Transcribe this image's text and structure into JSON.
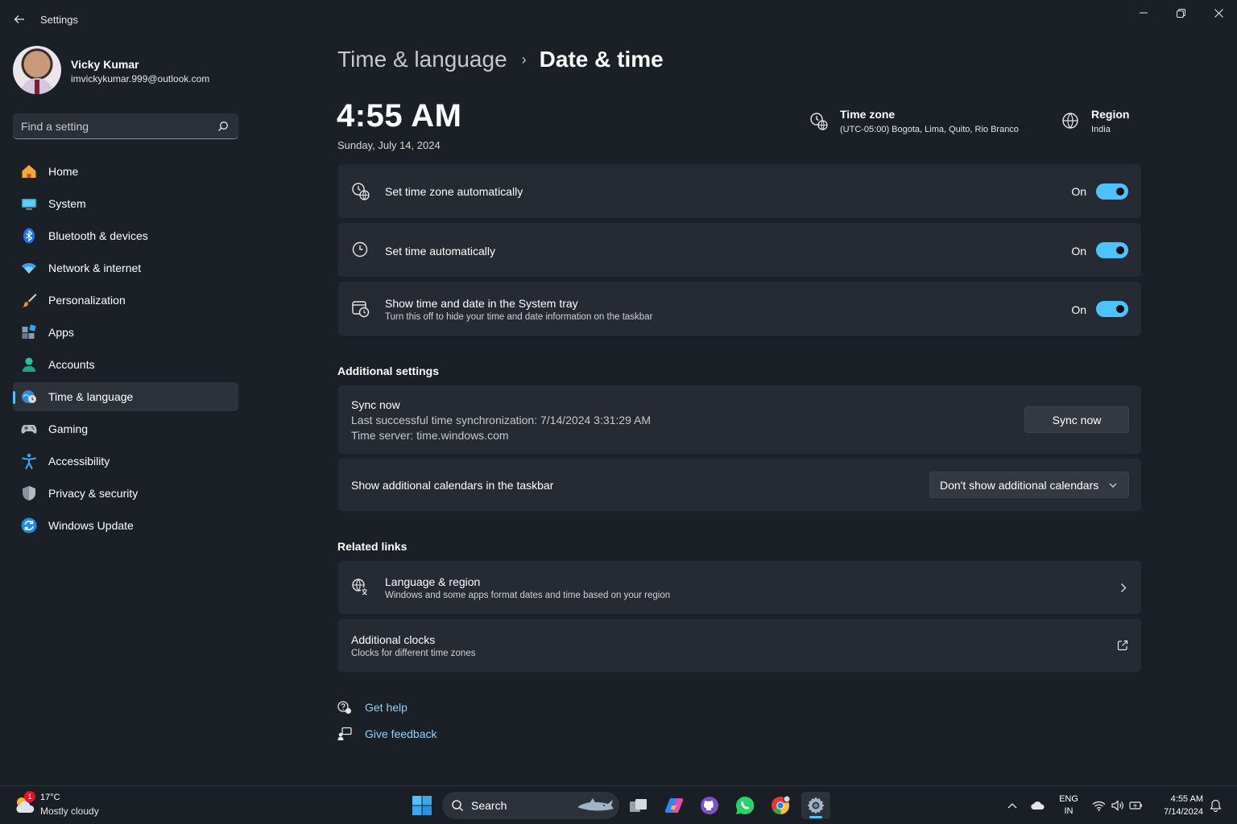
{
  "window": {
    "title": "Settings",
    "controls": {
      "minimize": "—",
      "restore": "❐",
      "close": "✕"
    }
  },
  "profile": {
    "name": "Vicky Kumar",
    "email": "imvickykumar.999@outlook.com"
  },
  "search": {
    "placeholder": "Find a setting"
  },
  "sidebar": {
    "items": [
      {
        "label": "Home",
        "icon": "home-icon"
      },
      {
        "label": "System",
        "icon": "system-icon"
      },
      {
        "label": "Bluetooth & devices",
        "icon": "bluetooth-icon"
      },
      {
        "label": "Network & internet",
        "icon": "wifi-icon"
      },
      {
        "label": "Personalization",
        "icon": "brush-icon"
      },
      {
        "label": "Apps",
        "icon": "apps-icon"
      },
      {
        "label": "Accounts",
        "icon": "accounts-icon"
      },
      {
        "label": "Time & language",
        "icon": "time-language-icon",
        "active": true
      },
      {
        "label": "Gaming",
        "icon": "gaming-icon"
      },
      {
        "label": "Accessibility",
        "icon": "accessibility-icon"
      },
      {
        "label": "Privacy & security",
        "icon": "shield-icon"
      },
      {
        "label": "Windows Update",
        "icon": "update-icon"
      }
    ]
  },
  "breadcrumb": {
    "parent": "Time & language",
    "separator": "›",
    "current": "Date & time"
  },
  "clock": {
    "time": "4:55 AM",
    "date": "Sunday, July 14, 2024"
  },
  "timezone": {
    "title": "Time zone",
    "value": "(UTC-05:00) Bogota, Lima, Quito, Rio Branco"
  },
  "region": {
    "title": "Region",
    "value": "India"
  },
  "settings": [
    {
      "title": "Set time zone automatically",
      "state": "On"
    },
    {
      "title": "Set time automatically",
      "state": "On"
    },
    {
      "title": "Show time and date in the System tray",
      "subtitle": "Turn this off to hide your time and date information on the taskbar",
      "state": "On"
    }
  ],
  "additional": {
    "heading": "Additional settings",
    "sync": {
      "title": "Sync now",
      "last": "Last successful time synchronization: 7/14/2024 3:31:29 AM",
      "server": "Time server: time.windows.com",
      "button": "Sync now"
    },
    "calendars": {
      "title": "Show additional calendars in the taskbar",
      "selected": "Don't show additional calendars"
    }
  },
  "related": {
    "heading": "Related links",
    "items": [
      {
        "title": "Language & region",
        "subtitle": "Windows and some apps format dates and time based on your region"
      },
      {
        "title": "Additional clocks",
        "subtitle": "Clocks for different time zones"
      }
    ]
  },
  "help": {
    "get_help": "Get help",
    "feedback": "Give feedback"
  },
  "taskbar": {
    "weather": {
      "temp": "17°C",
      "condition": "Mostly cloudy",
      "badge": "1"
    },
    "search_label": "Search",
    "lang_top": "ENG",
    "lang_bottom": "IN",
    "time": "4:55 AM",
    "date": "7/14/2024"
  },
  "colors": {
    "accent": "#4cc2ff",
    "background": "#1b2027",
    "card": "#262b33"
  }
}
